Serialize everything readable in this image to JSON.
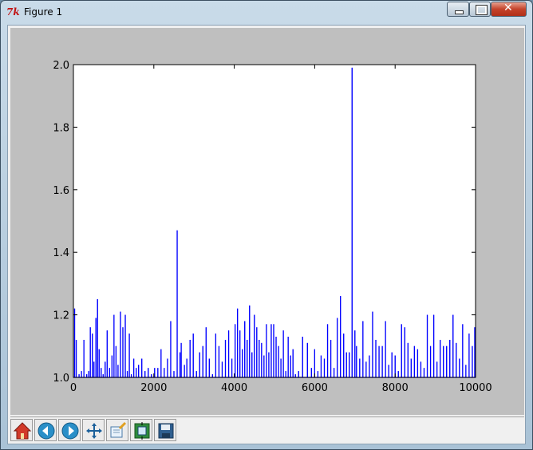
{
  "window": {
    "title": "Figure 1",
    "app_icon": "tk-feather-icon",
    "controls": [
      "minimize-icon",
      "maximize-icon",
      "close-icon"
    ]
  },
  "toolbar": {
    "buttons": [
      {
        "name": "home",
        "icon": "home-icon"
      },
      {
        "name": "back",
        "icon": "back-arrow-icon"
      },
      {
        "name": "forward",
        "icon": "forward-arrow-icon"
      },
      {
        "name": "pan",
        "icon": "pan-arrows-icon"
      },
      {
        "name": "zoom",
        "icon": "zoom-rect-icon"
      },
      {
        "name": "subplots",
        "icon": "subplots-config-icon"
      },
      {
        "name": "save",
        "icon": "floppy-disk-icon"
      }
    ]
  },
  "chart_data": {
    "type": "line",
    "title": "",
    "xlabel": "",
    "ylabel": "",
    "xlim": [
      0,
      10000
    ],
    "ylim": [
      1.0,
      2.0
    ],
    "xticks": [
      "0",
      "2000",
      "4000",
      "6000",
      "8000",
      "10000"
    ],
    "yticks": [
      "1.0",
      "1.2",
      "1.4",
      "1.6",
      "1.8",
      "2.0"
    ],
    "grid": false,
    "line_color": "#0000ff",
    "series": [
      {
        "x": [
          30,
          70,
          140,
          200,
          260,
          330,
          380,
          420,
          470,
          510,
          560,
          600,
          640,
          690,
          740,
          790,
          840,
          900,
          960,
          1010,
          1060,
          1110,
          1170,
          1230,
          1290,
          1340,
          1390,
          1440,
          1500,
          1560,
          1620,
          1700,
          1780,
          1860,
          1940,
          2020,
          2100,
          2180,
          2260,
          2340,
          2420,
          2500,
          2580,
          2650,
          2680,
          2760,
          2820,
          2900,
          2980,
          3060,
          3140,
          3220,
          3300,
          3380,
          3460,
          3540,
          3620,
          3700,
          3780,
          3860,
          3940,
          4020,
          4080,
          4140,
          4200,
          4260,
          4320,
          4380,
          4440,
          4500,
          4560,
          4620,
          4680,
          4740,
          4800,
          4860,
          4920,
          4980,
          5040,
          5100,
          5160,
          5220,
          5280,
          5340,
          5400,
          5460,
          5520,
          5600,
          5700,
          5820,
          5920,
          6000,
          6080,
          6160,
          6240,
          6320,
          6400,
          6480,
          6560,
          6640,
          6720,
          6790,
          6860,
          6930,
          7000,
          7040,
          7120,
          7200,
          7280,
          7360,
          7440,
          7520,
          7600,
          7680,
          7760,
          7840,
          7920,
          8000,
          8080,
          8160,
          8240,
          8320,
          8400,
          8480,
          8560,
          8640,
          8720,
          8800,
          8880,
          8960,
          9040,
          9120,
          9200,
          9280,
          9360,
          9440,
          9520,
          9600,
          9680,
          9760,
          9840,
          9920,
          9980
        ],
        "y": [
          1.22,
          1.12,
          1.01,
          1.02,
          1.12,
          1.01,
          1.02,
          1.16,
          1.14,
          1.05,
          1.19,
          1.25,
          1.09,
          1.03,
          1.01,
          1.05,
          1.15,
          1.03,
          1.07,
          1.2,
          1.1,
          1.04,
          1.21,
          1.16,
          1.2,
          1.02,
          1.14,
          1.01,
          1.06,
          1.03,
          1.04,
          1.06,
          1.02,
          1.03,
          1.01,
          1.03,
          1.03,
          1.09,
          1.03,
          1.06,
          1.18,
          1.02,
          1.47,
          1.08,
          1.11,
          1.04,
          1.06,
          1.12,
          1.14,
          1.02,
          1.08,
          1.1,
          1.16,
          1.06,
          1.01,
          1.14,
          1.1,
          1.05,
          1.12,
          1.15,
          1.06,
          1.17,
          1.22,
          1.15,
          1.09,
          1.18,
          1.12,
          1.23,
          1.08,
          1.2,
          1.16,
          1.12,
          1.11,
          1.07,
          1.17,
          1.08,
          1.17,
          1.17,
          1.13,
          1.1,
          1.06,
          1.15,
          1.02,
          1.13,
          1.07,
          1.09,
          1.01,
          1.02,
          1.13,
          1.11,
          1.03,
          1.09,
          1.02,
          1.07,
          1.06,
          1.17,
          1.12,
          1.03,
          1.19,
          1.26,
          1.14,
          1.08,
          1.08,
          1.99,
          1.15,
          1.1,
          1.06,
          1.18,
          1.05,
          1.07,
          1.21,
          1.12,
          1.1,
          1.1,
          1.18,
          1.04,
          1.08,
          1.07,
          1.02,
          1.17,
          1.16,
          1.11,
          1.06,
          1.1,
          1.09,
          1.05,
          1.03,
          1.2,
          1.1,
          1.2,
          1.05,
          1.12,
          1.1,
          1.1,
          1.12,
          1.2,
          1.11,
          1.06,
          1.17,
          1.04,
          1.14,
          1.1,
          1.16
        ]
      }
    ]
  }
}
